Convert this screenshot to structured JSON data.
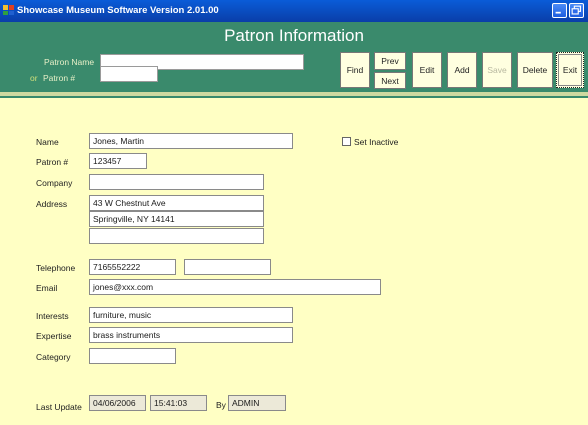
{
  "window": {
    "title": "Showcase Museum Software Version 2.01.00"
  },
  "header": {
    "page_title": "Patron Information",
    "patron_name_label": "Patron Name",
    "or_label": "or",
    "patron_num_label": "Patron #",
    "patron_name_value": "",
    "patron_num_value": ""
  },
  "toolbar": {
    "find": "Find",
    "prev": "Prev",
    "next": "Next",
    "edit": "Edit",
    "add": "Add",
    "save": "Save",
    "delete": "Delete",
    "exit": "Exit"
  },
  "form": {
    "labels": {
      "name": "Name",
      "patron_num": "Patron #",
      "company": "Company",
      "address": "Address",
      "telephone": "Telephone",
      "email": "Email",
      "interests": "Interests",
      "expertise": "Expertise",
      "category": "Category",
      "last_update": "Last Update",
      "by": "By",
      "set_inactive": "Set Inactive"
    },
    "values": {
      "name": "Jones, Martin",
      "patron_num": "123457",
      "company": "",
      "address_line1": "43 W Chestnut Ave",
      "address_line2": "Springville, NY 14141",
      "address_line3": "",
      "telephone": "7165552222",
      "telephone2": "",
      "email": "jones@xxx.com",
      "interests": "furniture, music",
      "expertise": "brass instruments",
      "category": "",
      "last_update_date": "04/06/2006",
      "last_update_time": "15:41:03",
      "updated_by": "ADMIN",
      "set_inactive_checked": "false"
    }
  },
  "colors": {
    "title_bar": "#0a4cc0",
    "header_green": "#3a8a6c",
    "form_bg": "#ffffc4"
  }
}
